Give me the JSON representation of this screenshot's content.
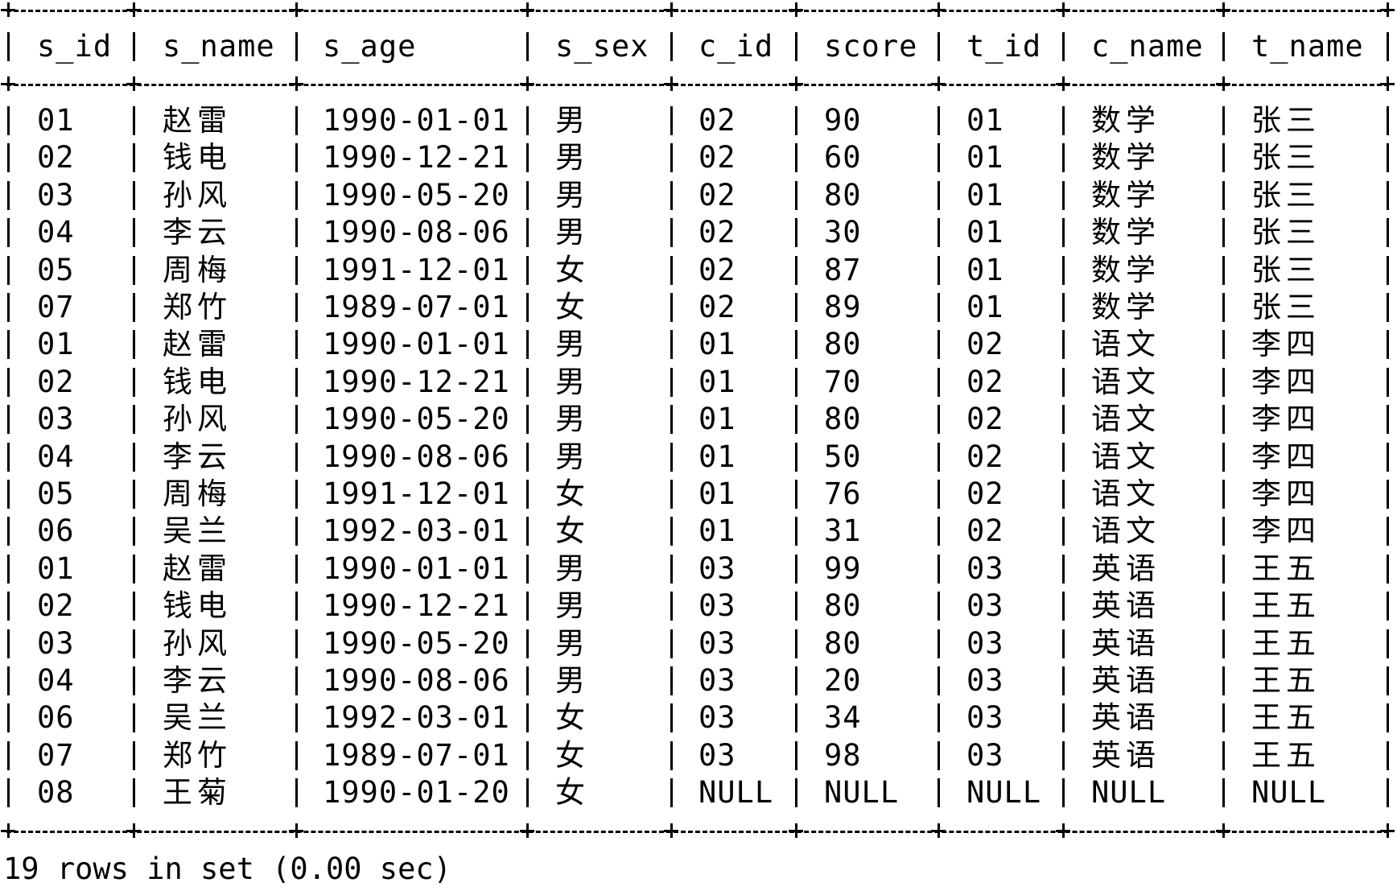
{
  "columns": [
    "s_id",
    "s_name",
    "s_age",
    "s_sex",
    "c_id",
    "score",
    "t_id",
    "c_name",
    "t_name"
  ],
  "rows": [
    [
      "01",
      "赵雷",
      "1990-01-01",
      "男",
      "02",
      "90",
      "01",
      "数学",
      "张三"
    ],
    [
      "02",
      "钱电",
      "1990-12-21",
      "男",
      "02",
      "60",
      "01",
      "数学",
      "张三"
    ],
    [
      "03",
      "孙风",
      "1990-05-20",
      "男",
      "02",
      "80",
      "01",
      "数学",
      "张三"
    ],
    [
      "04",
      "李云",
      "1990-08-06",
      "男",
      "02",
      "30",
      "01",
      "数学",
      "张三"
    ],
    [
      "05",
      "周梅",
      "1991-12-01",
      "女",
      "02",
      "87",
      "01",
      "数学",
      "张三"
    ],
    [
      "07",
      "郑竹",
      "1989-07-01",
      "女",
      "02",
      "89",
      "01",
      "数学",
      "张三"
    ],
    [
      "01",
      "赵雷",
      "1990-01-01",
      "男",
      "01",
      "80",
      "02",
      "语文",
      "李四"
    ],
    [
      "02",
      "钱电",
      "1990-12-21",
      "男",
      "01",
      "70",
      "02",
      "语文",
      "李四"
    ],
    [
      "03",
      "孙风",
      "1990-05-20",
      "男",
      "01",
      "80",
      "02",
      "语文",
      "李四"
    ],
    [
      "04",
      "李云",
      "1990-08-06",
      "男",
      "01",
      "50",
      "02",
      "语文",
      "李四"
    ],
    [
      "05",
      "周梅",
      "1991-12-01",
      "女",
      "01",
      "76",
      "02",
      "语文",
      "李四"
    ],
    [
      "06",
      "吴兰",
      "1992-03-01",
      "女",
      "01",
      "31",
      "02",
      "语文",
      "李四"
    ],
    [
      "01",
      "赵雷",
      "1990-01-01",
      "男",
      "03",
      "99",
      "03",
      "英语",
      "王五"
    ],
    [
      "02",
      "钱电",
      "1990-12-21",
      "男",
      "03",
      "80",
      "03",
      "英语",
      "王五"
    ],
    [
      "03",
      "孙风",
      "1990-05-20",
      "男",
      "03",
      "80",
      "03",
      "英语",
      "王五"
    ],
    [
      "04",
      "李云",
      "1990-08-06",
      "男",
      "03",
      "20",
      "03",
      "英语",
      "王五"
    ],
    [
      "06",
      "吴兰",
      "1992-03-01",
      "女",
      "03",
      "34",
      "03",
      "英语",
      "王五"
    ],
    [
      "07",
      "郑竹",
      "1989-07-01",
      "女",
      "03",
      "98",
      "03",
      "英语",
      "王五"
    ],
    [
      "08",
      "王菊",
      "1990-01-20",
      "女",
      "NULL",
      "NULL",
      "NULL",
      "NULL",
      "NULL"
    ]
  ],
  "footer": "19 rows in set (0.00 sec)"
}
